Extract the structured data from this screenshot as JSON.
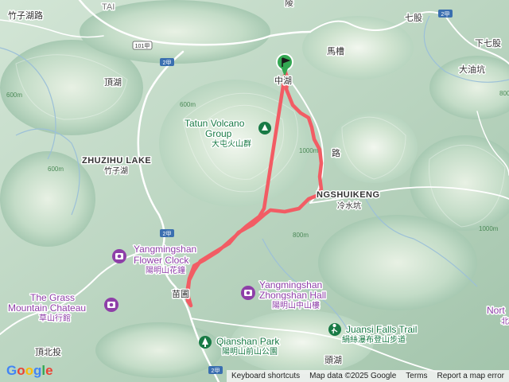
{
  "map": {
    "labels": {
      "zhuzihu_road": "竹子湖路",
      "tai": "TAI",
      "top_char": "陵",
      "qigu": "七股",
      "xiaqigu": "下七股",
      "mazao": "馬槽",
      "dayoukeng": "大油坑",
      "dinghu": "頂湖",
      "zhonghu": "中湖",
      "zhuzihu_lake_en": "ZHUZIHU LAKE",
      "zhuzihu_lake_zh": "竹子湖",
      "lengshuikeng_en": "NGSHUIKENG",
      "lengshuikeng_zh": "冷水坑",
      "tatun_en_1": "Tatun Volcano",
      "tatun_en_2": "Group",
      "tatun_zh": "大屯火山群",
      "flower_clock_en_1": "Yangmingshan",
      "flower_clock_en_2": "Flower Clock",
      "flower_clock_zh": "陽明山花鐘",
      "grass_chateau_en_1": "The Grass",
      "grass_chateau_en_2": "Mountain Chateau",
      "grass_chateau_zh": "草山行館",
      "zhongshan_hall_en_1": "Yangmingshan",
      "zhongshan_hall_en_2": "Zhongshan Hall",
      "zhongshan_hall_zh": "陽明山中山樓",
      "qianshan_park_en": "Qianshan Park",
      "qianshan_park_zh": "陽明山前山公園",
      "juansi_falls_en": "Juansi Falls Trail",
      "juansi_falls_zh": "絹絲瀑布登山步道",
      "miaopu": "苗圃",
      "dingbeitou": "頂北投",
      "toucuo": "頭湖",
      "north_partial": "Nort",
      "north_partial_zh": "北",
      "road_segment": "路"
    },
    "route_badges": [
      "101甲",
      "2甲",
      "2甲",
      "2甲",
      "2甲"
    ],
    "contours": [
      "600m",
      "800m",
      "600m",
      "800m",
      "1000m",
      "600m",
      "1000m"
    ]
  },
  "attribution": {
    "shortcuts": "Keyboard shortcuts",
    "map_data": "Map data ©2025 Google",
    "terms": "Terms",
    "report": "Report a map error"
  },
  "logo": {
    "g1": "G",
    "g2": "o",
    "g3": "o",
    "g4": "g",
    "g5": "l",
    "g6": "e"
  },
  "colors": {
    "track": "#f25c64",
    "start_marker": "#34a853",
    "poi": "#8e3fa8",
    "park": "#187a45",
    "roads": "#ffffff",
    "rivers": "#9cc0d8"
  }
}
